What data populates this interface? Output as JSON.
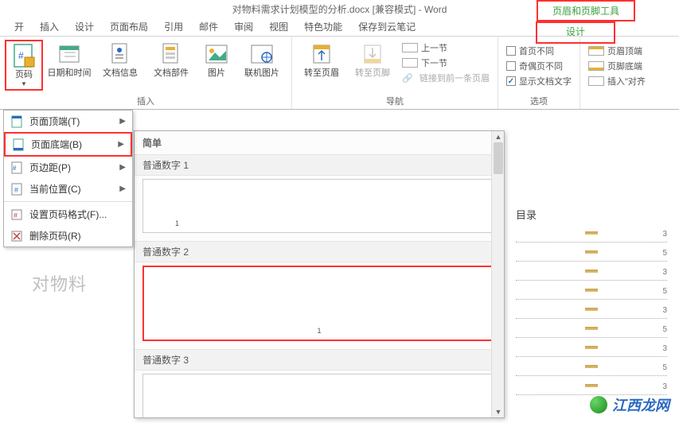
{
  "title": "对物料需求计划模型的分析.docx [兼容模式] - Word",
  "contextual_tab_group": "页眉和页脚工具",
  "contextual_tab": "设计",
  "tabs": [
    "开",
    "插入",
    "设计",
    "页面布局",
    "引用",
    "邮件",
    "审阅",
    "视图",
    "特色功能",
    "保存到云笔记"
  ],
  "ribbon": {
    "page_number": "页码",
    "date_time": "日期和时间",
    "doc_info": "文档信息",
    "doc_parts": "文档部件",
    "picture": "图片",
    "online_pic": "联机图片",
    "goto_header": "转至页眉",
    "goto_footer": "转至页脚",
    "prev_section": "上一节",
    "next_section": "下一节",
    "link_prev": "链接到前一条页眉",
    "first_diff": "首页不同",
    "odd_even_diff": "奇偶页不同",
    "show_doc_text": "显示文档文字",
    "header_top": "页眉顶端",
    "footer_bottom": "页脚底端",
    "insert_align": "插入\"对齐",
    "group_insert": "插入",
    "group_nav": "导航",
    "group_options": "选项"
  },
  "dropdown": {
    "page_top": "页面顶端(T)",
    "page_bottom": "页面底端(B)",
    "margins": "页边距(P)",
    "current_pos": "当前位置(C)",
    "format": "设置页码格式(F)...",
    "remove": "删除页码(R)"
  },
  "submenu": {
    "simple": "简单",
    "plain1": "普通数字 1",
    "plain2": "普通数字 2",
    "plain3": "普通数字 3",
    "sample": "1"
  },
  "doc_text": "对物料",
  "toc": {
    "title": "目录",
    "pages": [
      "3",
      "5",
      "3",
      "5",
      "3",
      "5",
      "3",
      "5",
      "3"
    ]
  },
  "watermark": "江西龙网"
}
